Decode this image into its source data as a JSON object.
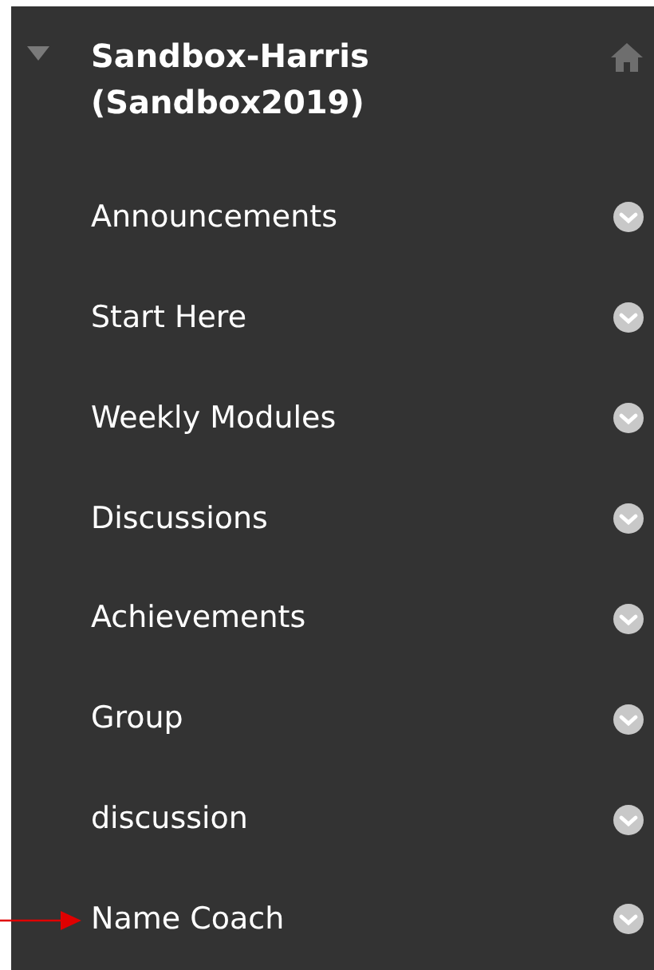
{
  "course": {
    "title": "Sandbox-Harris (Sandbox2019)",
    "expanded": true
  },
  "menu_items": [
    {
      "label": "Announcements"
    },
    {
      "label": "Start Here"
    },
    {
      "label": "Weekly Modules"
    },
    {
      "label": "Discussions"
    },
    {
      "label": "Achievements"
    },
    {
      "label": "Group"
    },
    {
      "label": "discussion"
    },
    {
      "label": "Name Coach",
      "annotated": true
    }
  ]
}
